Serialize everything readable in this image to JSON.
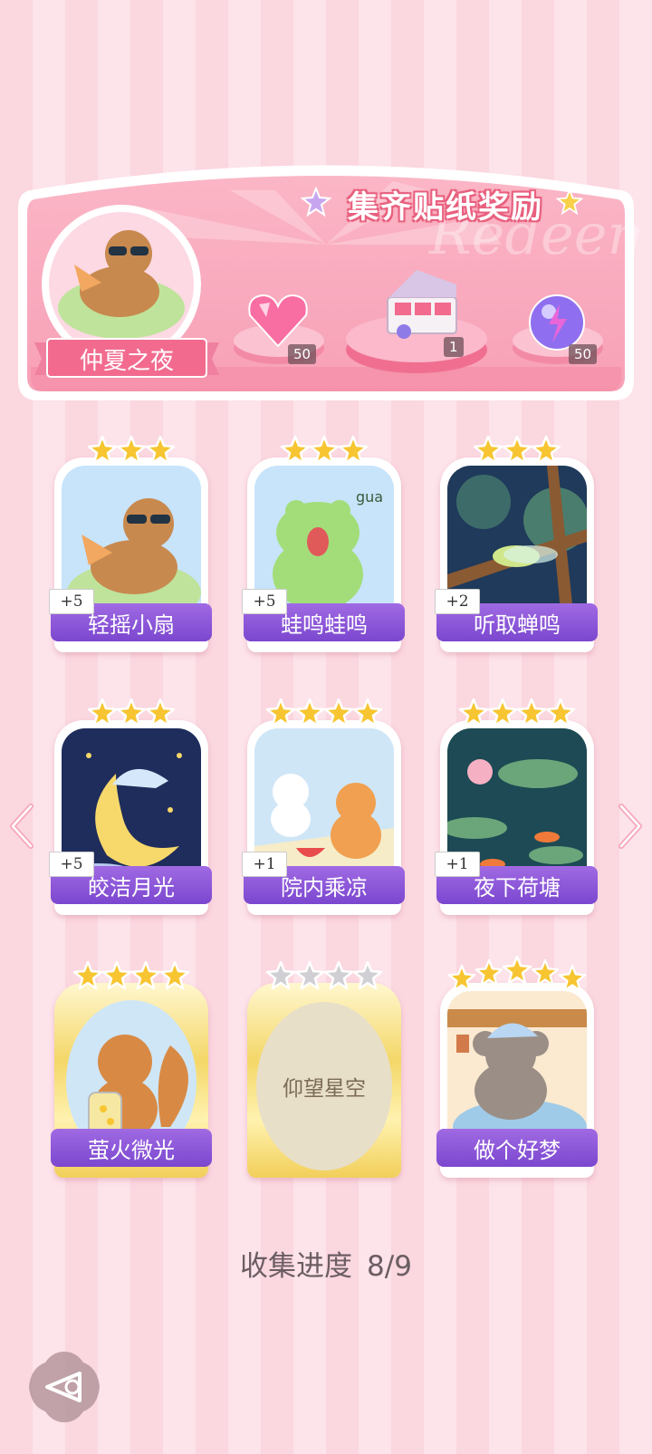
{
  "banner": {
    "title": "集齐贴纸奖励",
    "watermark": "Redeem",
    "event_name": "仲夏之夜",
    "rewards": [
      {
        "icon": "pink-heart-gem-icon",
        "count": "50"
      },
      {
        "icon": "gift-box-icon",
        "count": "1"
      },
      {
        "icon": "purple-energy-orb-icon",
        "count": "50"
      }
    ]
  },
  "stickers": [
    {
      "name": "轻摇小扇",
      "stars": 3,
      "bonus": "+5",
      "art": "capybara-fan"
    },
    {
      "name": "蛙鸣蛙鸣",
      "stars": 3,
      "bonus": "+5",
      "art": "frog",
      "art_text": "gua"
    },
    {
      "name": "听取蝉鸣",
      "stars": 3,
      "bonus": "+2",
      "art": "cicada"
    },
    {
      "name": "皎洁月光",
      "stars": 3,
      "bonus": "+5",
      "art": "moon"
    },
    {
      "name": "院内乘凉",
      "stars": 4,
      "bonus": "+1",
      "art": "cats-watermelon"
    },
    {
      "name": "夜下荷塘",
      "stars": 4,
      "bonus": "+1",
      "art": "lotus-pond"
    },
    {
      "name": "萤火微光",
      "stars": 4,
      "bonus": "",
      "art": "squirrel-firefly",
      "rarity": "gold"
    },
    {
      "name": "仰望星空",
      "stars": 4,
      "bonus": "",
      "art": "locked",
      "locked": true,
      "rarity": "gold"
    },
    {
      "name": "做个好梦",
      "stars": 5,
      "bonus": "",
      "art": "koala-sleep"
    }
  ],
  "progress": {
    "label": "收集进度",
    "value": "8/9"
  },
  "colors": {
    "label_purple": "#8a55d8",
    "star_gold": "#f7c531",
    "banner_pink": "#f58ca6"
  }
}
